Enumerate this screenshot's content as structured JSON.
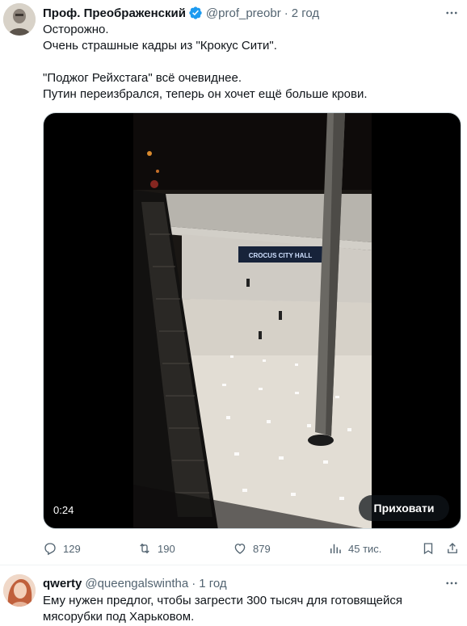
{
  "tweet": {
    "author_name": "Проф. Преображенский",
    "handle": "@prof_preobr",
    "separator": "·",
    "time": "2 год",
    "lines": [
      "Осторожно.",
      "Очень страшные кадры из \"Крокус Сити\".",
      "",
      "\"Поджог Рейхстага\" всё очевиднее.",
      "Путин переизбрался, теперь он хочет ещё больше крови."
    ],
    "video": {
      "duration": "0:24",
      "hide_label": "Приховати",
      "sign_text": "CROCUS CITY HALL"
    },
    "actions": {
      "replies": "129",
      "reposts": "190",
      "likes": "879",
      "views": "45 тис."
    }
  },
  "reply": {
    "author_name": "qwerty",
    "handle": "@queengalswintha",
    "separator": "·",
    "time": "1 год",
    "lines": [
      "Ему нужен предлог, чтобы загрести 300 тысяч для готовящейся",
      "мясорубки под Харьковом."
    ]
  },
  "colors": {
    "verified": "#1d9bf0",
    "secondary_text": "#536471",
    "primary_text": "#0f1419"
  }
}
